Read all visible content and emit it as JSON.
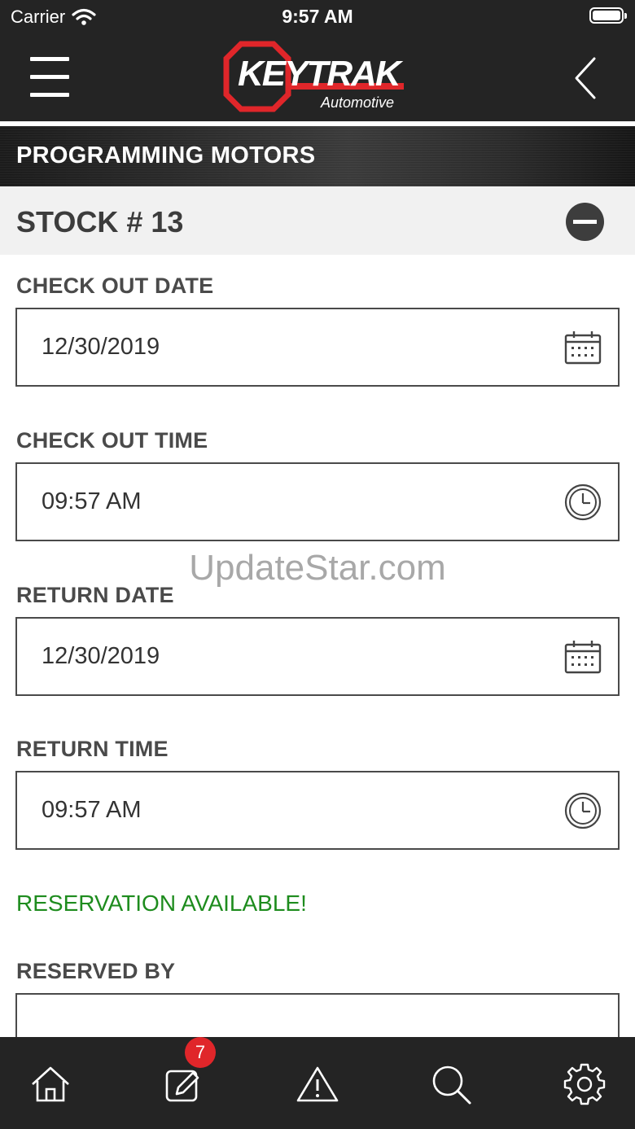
{
  "status_bar": {
    "carrier": "Carrier",
    "time": "9:57 AM"
  },
  "header": {
    "logo_text": "KEYTRAK",
    "logo_subtext": "Automotive",
    "menu_icon": "hamburger-icon",
    "back_icon": "chevron-left-icon"
  },
  "section": {
    "title": "PROGRAMMING MOTORS"
  },
  "stock": {
    "title": "STOCK # 13",
    "collapse_icon": "minus-circle-icon"
  },
  "form": {
    "check_out_date": {
      "label": "CHECK OUT DATE",
      "value": "12/30/2019",
      "icon": "calendar-icon"
    },
    "check_out_time": {
      "label": "CHECK OUT TIME",
      "value": "09:57 AM",
      "icon": "clock-icon"
    },
    "return_date": {
      "label": "RETURN DATE",
      "value": "12/30/2019",
      "icon": "calendar-icon"
    },
    "return_time": {
      "label": "RETURN TIME",
      "value": "09:57 AM",
      "icon": "clock-icon"
    },
    "status": "RESERVATION AVAILABLE!",
    "reserved_by": {
      "label": "RESERVED BY",
      "value": ""
    }
  },
  "watermark": "UpdateStar.com",
  "tab_bar": {
    "items": [
      {
        "icon": "home-icon"
      },
      {
        "icon": "edit-icon",
        "badge": "7"
      },
      {
        "icon": "warning-icon"
      },
      {
        "icon": "search-icon"
      },
      {
        "icon": "gear-icon"
      }
    ]
  },
  "colors": {
    "dark_bg": "#242424",
    "accent_red": "#e0262a",
    "status_green": "#1e8c1e",
    "stock_bar_bg": "#f1f1f1"
  }
}
